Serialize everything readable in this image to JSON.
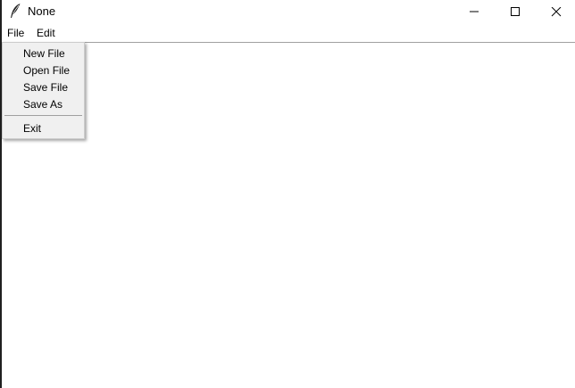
{
  "window": {
    "title": "None",
    "icon": "feather-icon",
    "controls": {
      "minimize_icon": "minimize-icon",
      "maximize_icon": "maximize-icon",
      "close_icon": "close-icon"
    }
  },
  "menubar": {
    "items": [
      {
        "label": "File"
      },
      {
        "label": "Edit"
      }
    ]
  },
  "file_menu": {
    "items": [
      {
        "label": "New File"
      },
      {
        "label": "Open File"
      },
      {
        "label": "Save File"
      },
      {
        "label": "Save As"
      },
      {
        "label": "Exit"
      }
    ]
  },
  "colors": {
    "window_bg": "#ffffff",
    "menu_bg": "#f0f0f0",
    "separator": "#a0a0a0",
    "text": "#000000"
  }
}
